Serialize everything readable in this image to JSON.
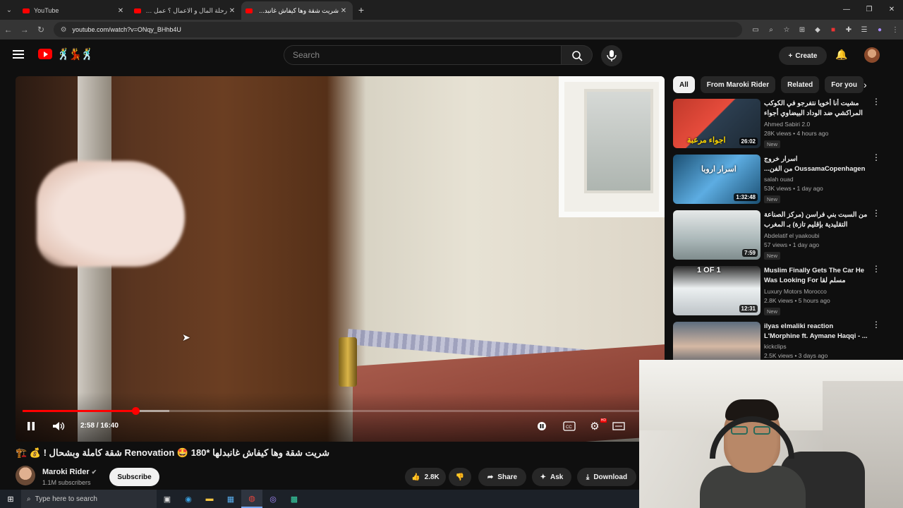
{
  "browser": {
    "tabs": [
      {
        "title": "YouTube",
        "active": false
      },
      {
        "title": "رحلة المال و الاعمال ؟ عمل جديد",
        "active": false
      },
      {
        "title": "شريت شقة وها كيفاش غانبد...",
        "active": true
      }
    ],
    "url": "youtube.com/watch?v=ONqy_BHhb4U"
  },
  "header": {
    "search_placeholder": "Search",
    "create_label": "Create"
  },
  "player": {
    "time_display": "2:58 / 16:40",
    "progress_fraction": 0.178,
    "buffer_fraction": 0.231,
    "hd_badge": "HD"
  },
  "video": {
    "title": "شريت شقة وها كيفاش غانبدلها *180 🤩 Renovation شقة كاملة وبشحال ! 💰 🏗️",
    "channel": "Maroki Rider",
    "subscribers": "1.1M subscribers",
    "subscribe_label": "Subscribe",
    "likes": "2.8K",
    "share_label": "Share",
    "ask_label": "Ask",
    "download_label": "Download"
  },
  "sidebar": {
    "chips": [
      "All",
      "From Maroki Rider",
      "Related",
      "For you"
    ],
    "recommendations": [
      {
        "title": "مشيت أنا أخويا نتفرجو في الكوكب المراكشي ضد الوداد البيضاوي أجواء ... 🤩",
        "channel": "Ahmed Sabiri 2.0",
        "stats": "28K views • 4 hours ago",
        "badge": "New",
        "duration": "26:02",
        "thumb_text": "اجواء مرعبة"
      },
      {
        "title": "اسرار خروج OussamaCopenhagen من الفن...",
        "channel": "salah ouad",
        "stats": "53K views • 1 day ago",
        "badge": "New",
        "duration": "1:32:48",
        "thumb_text": "اسرار اروبا"
      },
      {
        "title": "من السبت بني فراسن (مركز الصناعة التقليدية بإقليم تازة) بـ المغرب وكاكتشف سوقها",
        "channel": "Abdelatif el yaakoubi",
        "stats": "57 views • 1 day ago",
        "badge": "New",
        "duration": "7:59",
        "thumb_text": ""
      },
      {
        "title": "Muslim Finally Gets The Car He Was Looking For مسلم لقا الطوموبيل",
        "channel": "Luxury Motors Morocco",
        "stats": "2.8K views • 5 hours ago",
        "badge": "New",
        "duration": "12:31",
        "thumb_text": "1 OF 1"
      },
      {
        "title": "ilyas elmaliki reaction L'Morphine ft. Aymane Haqqi - ...",
        "channel": "kickclips",
        "stats": "2.5K views • 3 days ago",
        "badge": "",
        "duration": "",
        "thumb_text": ""
      }
    ]
  },
  "taskbar": {
    "search_placeholder": "Type here to search"
  },
  "colors": {
    "accent": "#ff0000",
    "background": "#0f0f0f"
  }
}
